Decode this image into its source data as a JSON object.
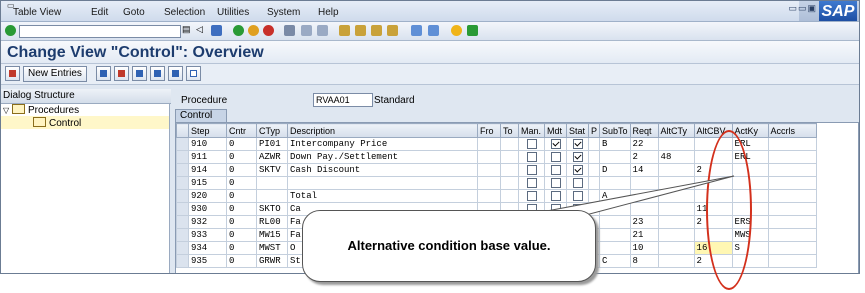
{
  "menu": [
    "Table View",
    "Edit",
    "Goto",
    "Selection",
    "Utilities",
    "System",
    "Help"
  ],
  "title": "Change View \"Control\": Overview",
  "app_toolbar": {
    "new_entries": "New Entries"
  },
  "tree": {
    "header": "Dialog Structure",
    "items": [
      {
        "label": "Procedures",
        "level": 1
      },
      {
        "label": "Control",
        "level": 2,
        "selected": true
      }
    ]
  },
  "procedure": {
    "label": "Procedure",
    "value": "RVAA01",
    "description": "Standard"
  },
  "tab": "Control",
  "columns": [
    "Step",
    "Cntr",
    "CTyp",
    "Description",
    "Fro",
    "To",
    "Man.",
    "Mdt",
    "Stat",
    "P",
    "SubTo",
    "Reqt",
    "AltCTy",
    "AltCBV",
    "ActKy",
    "Accrls"
  ],
  "rows": [
    {
      "step": "910",
      "cntr": "0",
      "ctyp": "PI01",
      "desc": "Intercompany Price",
      "man": false,
      "mdt": true,
      "stat": true,
      "p": "",
      "subto": "B",
      "reqt": "22",
      "altcty": "",
      "altcbv": "",
      "actky": "ERL"
    },
    {
      "step": "911",
      "cntr": "0",
      "ctyp": "AZWR",
      "desc": "Down Pay./Settlement",
      "man": false,
      "mdt": false,
      "stat": true,
      "p": "",
      "subto": "",
      "reqt": "2",
      "altcty": "48",
      "altcbv": "",
      "actky": "ERL"
    },
    {
      "step": "914",
      "cntr": "0",
      "ctyp": "SKTV",
      "desc": "Cash Discount",
      "man": false,
      "mdt": false,
      "stat": true,
      "p": "",
      "subto": "D",
      "reqt": "14",
      "altcty": "",
      "altcbv": "2",
      "actky": ""
    },
    {
      "step": "915",
      "cntr": "0",
      "ctyp": "",
      "desc": "",
      "man": false,
      "mdt": false,
      "stat": false,
      "p": "",
      "subto": "",
      "reqt": "",
      "altcty": "",
      "altcbv": "",
      "actky": ""
    },
    {
      "step": "920",
      "cntr": "0",
      "ctyp": "",
      "desc": "Total",
      "man": false,
      "mdt": false,
      "stat": false,
      "p": "",
      "subto": "A",
      "reqt": "",
      "altcty": "",
      "altcbv": "",
      "actky": ""
    },
    {
      "step": "930",
      "cntr": "0",
      "ctyp": "SKTO",
      "desc": "Ca",
      "man": false,
      "mdt": false,
      "stat": true,
      "p": "",
      "subto": "",
      "reqt": "",
      "altcty": "",
      "altcbv": "11",
      "actky": ""
    },
    {
      "step": "932",
      "cntr": "0",
      "ctyp": "RL00",
      "desc": "Fa",
      "man": false,
      "mdt": false,
      "stat": true,
      "p": "",
      "subto": "",
      "reqt": "23",
      "altcty": "",
      "altcbv": "2",
      "actky": "ERS"
    },
    {
      "step": "933",
      "cntr": "0",
      "ctyp": "MW15",
      "desc": "Fa",
      "man": false,
      "mdt": false,
      "stat": true,
      "p": "",
      "subto": "",
      "reqt": "21",
      "altcty": "",
      "altcbv": "",
      "actky": "MWS"
    },
    {
      "step": "934",
      "cntr": "0",
      "ctyp": "MWST",
      "desc": "O",
      "man": false,
      "mdt": false,
      "stat": false,
      "p": "S",
      "subto": "",
      "reqt": "10",
      "altcty": "",
      "altcbv": "16",
      "actky": "S"
    },
    {
      "step": "935",
      "cntr": "0",
      "ctyp": "GRWR",
      "desc": "St",
      "man": false,
      "mdt": false,
      "stat": true,
      "p": "",
      "subto": "C",
      "reqt": "8",
      "altcty": "",
      "altcbv": "2",
      "actky": ""
    }
  ],
  "callout": "Alternative condition base value.",
  "logo_text": "SAP",
  "colors": {
    "title": "#1d3c6e",
    "highlight_ellipse": "#d3301c",
    "selection": "#fff7c9"
  }
}
